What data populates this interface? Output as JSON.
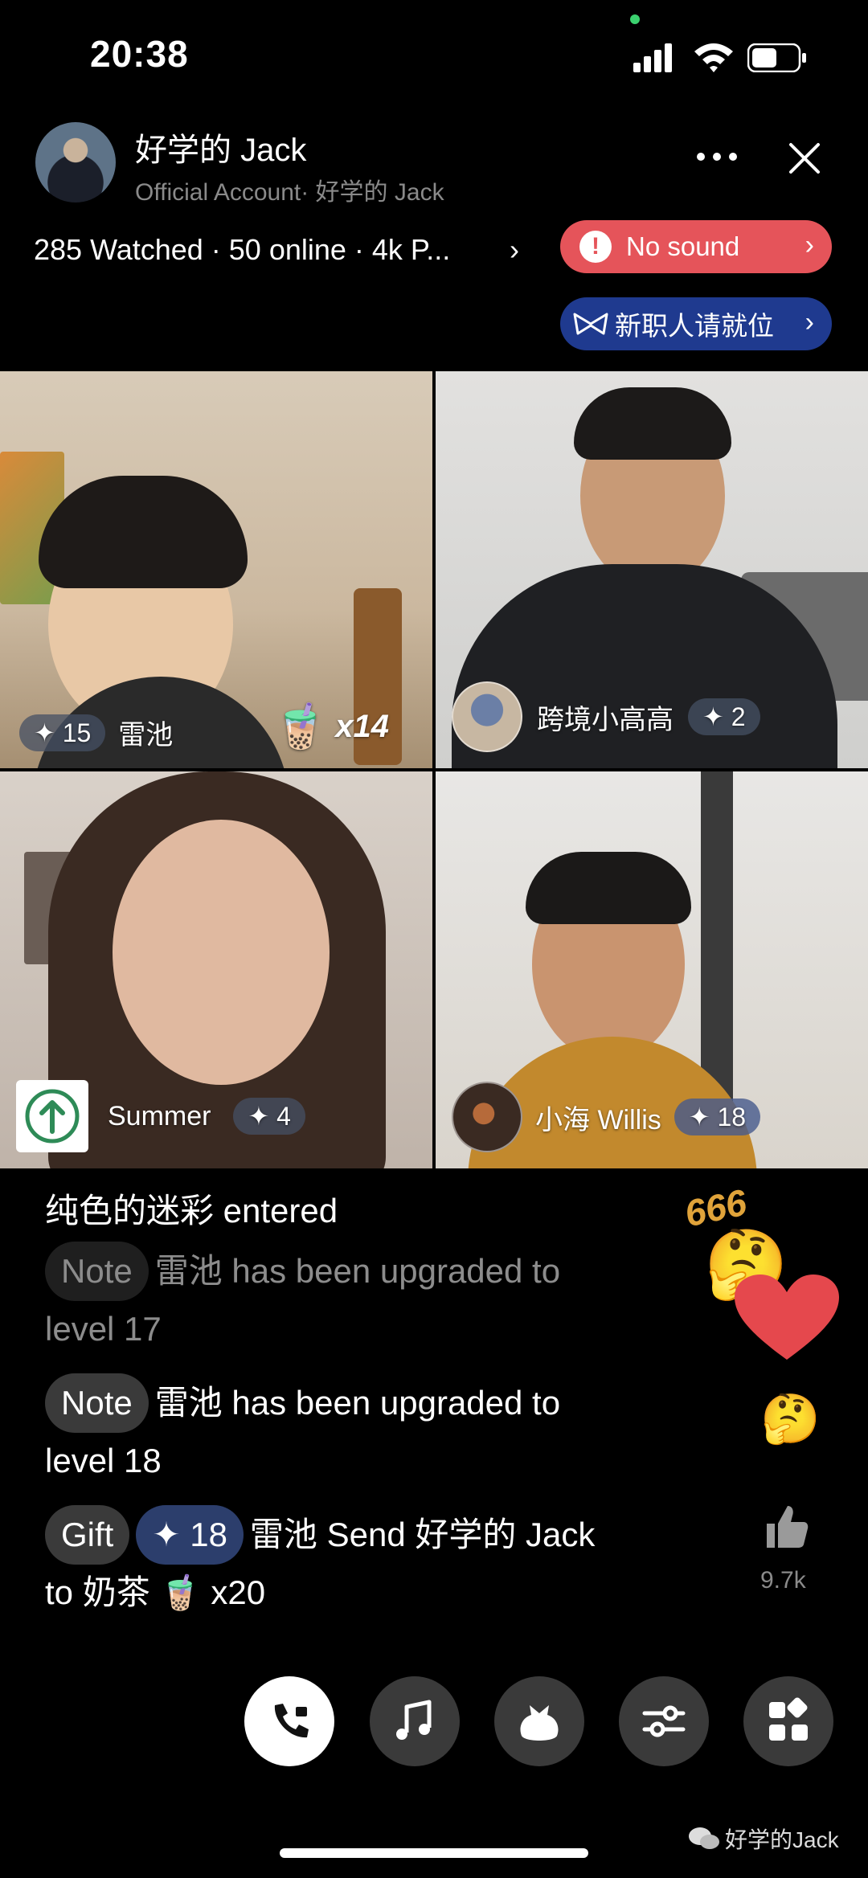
{
  "status_bar": {
    "time": "20:38"
  },
  "header": {
    "host_name": "好学的 Jack",
    "host_sub": "Official Account· 好学的 Jack",
    "stats": "285 Watched · 50 online · 4k P...",
    "stats_chevron": "›",
    "no_sound_label": "No sound",
    "no_sound_chevron": "›",
    "alert_glyph": "!",
    "new_job_label": "新职人请就位",
    "new_job_chevron": "›"
  },
  "tiles": [
    {
      "name": "雷池",
      "badge": "✦ 15",
      "gift_count": "x14"
    },
    {
      "name": "跨境小高高",
      "badge": "✦ 2"
    },
    {
      "name": "Summer",
      "badge": "✦ 4"
    },
    {
      "name": "小海 Willis",
      "badge": "✦ 18"
    }
  ],
  "chat": [
    {
      "text": "纯色的迷彩 entered"
    },
    {
      "tag": "Note",
      "text": "雷池 has been upgraded to",
      "text2": "level 17"
    },
    {
      "tag": "Note",
      "text": "雷池 has been upgraded to",
      "text2": "level 18"
    },
    {
      "tag": "Gift",
      "badge": "✦ 18",
      "text": "雷池 Send 好学的 Jack",
      "text2": "to 奶茶 🧋 x20"
    }
  ],
  "side": {
    "emoji_666": "666",
    "like_count": "9.7k"
  },
  "bottom_bar": {
    "buttons": [
      "call-icon",
      "music-icon",
      "gift-bag-icon",
      "settings-sliders-icon",
      "apps-grid-icon"
    ]
  },
  "watermark": "好学的Jack",
  "colors": {
    "no_sound_bg": "#e5545a",
    "new_job_bg": "#1f3a8f",
    "background": "#000000"
  }
}
